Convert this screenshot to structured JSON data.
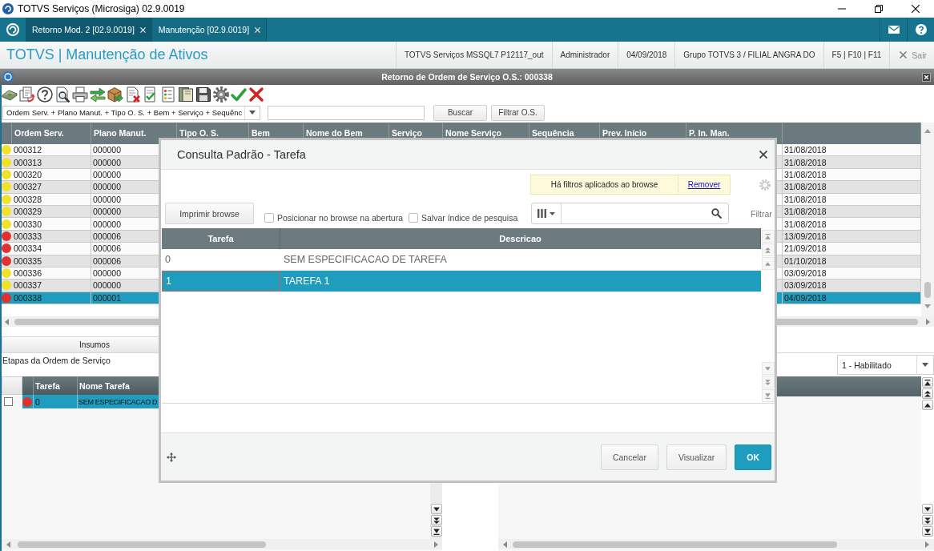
{
  "window": {
    "title": "TOTVS Serviços (Microsiga) 02.9.0019"
  },
  "tabs": [
    {
      "label": "Retorno Mod. 2 [02.9.0019]",
      "selected": true
    },
    {
      "label": "Manutenção [02.9.0019]",
      "selected": false
    }
  ],
  "header": {
    "title": "TOTVS | Manutenção de Ativos",
    "info": [
      "TOTVS Serviços MSSQL7 P12117_out",
      "Administrador",
      "04/09/2018",
      "Grupo TOTVS 3 / FILIAL ANGRA DO",
      "F5 | F10 | F11"
    ],
    "exit": "Sair"
  },
  "form": {
    "title": "Retorno de Ordem de Serviço O.S.: 000338"
  },
  "search": {
    "index": "Ordem Serv. + Plano Manut. + Tipo O. S. + Bem + Serviço + Sequênc",
    "buttons": [
      "Buscar",
      "Filtrar O.S."
    ]
  },
  "orders_table": {
    "columns": [
      "Ordem Serv.",
      "Plano Manut.",
      "Tipo O. S.",
      "Bem",
      "Nome do Bem",
      "Serviço",
      "Nome Serviço",
      "Sequência",
      "Prev. Início",
      "P. In. Man."
    ],
    "rows": [
      {
        "color": "#f0e22a",
        "ordem_serv": "000312",
        "plano_manut": "000000",
        "column_11": "31/08/2018",
        "selected": false
      },
      {
        "color": "#f0e22a",
        "ordem_serv": "000313",
        "plano_manut": "000000",
        "column_11": "31/08/2018",
        "selected": false
      },
      {
        "color": "#f0e22a",
        "ordem_serv": "000320",
        "plano_manut": "000000",
        "column_11": "31/08/2018",
        "selected": false
      },
      {
        "color": "#f0e22a",
        "ordem_serv": "000327",
        "plano_manut": "000000",
        "column_11": "31/08/2018",
        "selected": false
      },
      {
        "color": "#f0e22a",
        "ordem_serv": "000328",
        "plano_manut": "000000",
        "column_11": "31/08/2018",
        "selected": false
      },
      {
        "color": "#f0e22a",
        "ordem_serv": "000329",
        "plano_manut": "000000",
        "column_11": "31/08/2018",
        "selected": false
      },
      {
        "color": "#f0e22a",
        "ordem_serv": "000330",
        "plano_manut": "000000",
        "column_11": "31/08/2018",
        "selected": false
      },
      {
        "color": "#e23030",
        "ordem_serv": "000333",
        "plano_manut": "000006",
        "column_11": "13/09/2018",
        "selected": false
      },
      {
        "color": "#e23030",
        "ordem_serv": "000334",
        "plano_manut": "000006",
        "column_11": "21/09/2018",
        "selected": false
      },
      {
        "color": "#e23030",
        "ordem_serv": "000335",
        "plano_manut": "000006",
        "column_11": "01/10/2018",
        "selected": false
      },
      {
        "color": "#f0e22a",
        "ordem_serv": "000336",
        "plano_manut": "000000",
        "column_11": "03/09/2018",
        "selected": false
      },
      {
        "color": "#f0e22a",
        "ordem_serv": "000337",
        "plano_manut": "000000",
        "column_11": "03/09/2018",
        "selected": false
      },
      {
        "color": "#e23030",
        "ordem_serv": "000338",
        "plano_manut": "000001",
        "column_11": "04/09/2018",
        "selected": true
      }
    ]
  },
  "folder_tab": "Insumos",
  "steps": {
    "label": "Etapas da Ordem de Serviço",
    "columns": [
      "Tarefa",
      "Nome Tarefa"
    ],
    "rows": [
      {
        "checked": false,
        "color": "#e23030",
        "tarefa": "0",
        "nome_tarefa": "SEM ESPECIFICACAO D",
        "selected": true
      }
    ]
  },
  "status_filter": {
    "value": "1 - Habilitado"
  },
  "dialog": {
    "title": "Consulta Padrão - Tarefa",
    "notice": "Há filtros aplicados ao browse",
    "notice_link": "Remover",
    "print_button": "Imprimir browse",
    "options": [
      {
        "label": "Posicionar no browse na abertura",
        "checked": false
      },
      {
        "label": "Salvar índice de pesquisa",
        "checked": false
      }
    ],
    "filter_label": "Filtrar",
    "columns": [
      "Tarefa",
      "Descricao"
    ],
    "rows": [
      {
        "tarefa": "0",
        "descricao": "SEM ESPECIFICACAO DE TAREFA",
        "selected": false
      },
      {
        "tarefa": "1",
        "descricao": "TAREFA 1",
        "selected": true
      }
    ],
    "buttons": [
      {
        "label": "Cancelar",
        "kind": "secondary"
      },
      {
        "label": "Visualizar",
        "kind": "secondary"
      },
      {
        "label": "OK",
        "kind": "primary"
      }
    ]
  }
}
